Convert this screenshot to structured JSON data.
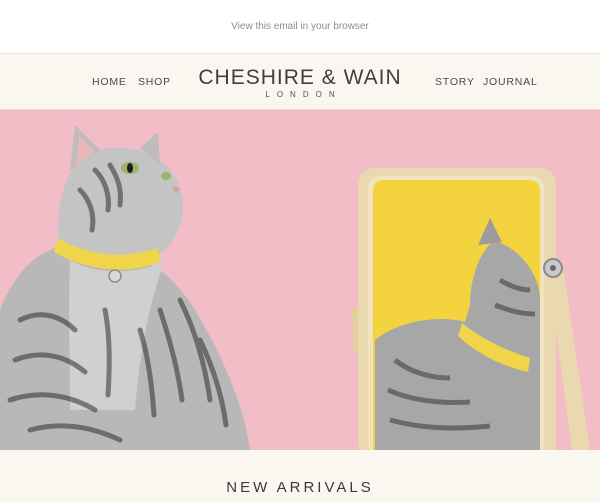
{
  "topbar": {
    "view_in_browser": "View this email in your browser"
  },
  "header": {
    "nav_left": [
      "HOME",
      "SHOP"
    ],
    "nav_right": [
      "STORY",
      "JOURNAL"
    ],
    "logo_brand": "CHESHIRE & WAIN",
    "logo_city": "LONDON"
  },
  "hero": {
    "image_alt": "Tabby cat wearing a yellow collar looking at its reflection in a wooden mirror",
    "colors": {
      "background": "#f2bdc6",
      "mirror_glass": "#f3d43f",
      "collar": "#f0d44a",
      "mirror_frame": "#ead9ae"
    }
  },
  "section": {
    "heading": "NEW ARRIVALS"
  }
}
